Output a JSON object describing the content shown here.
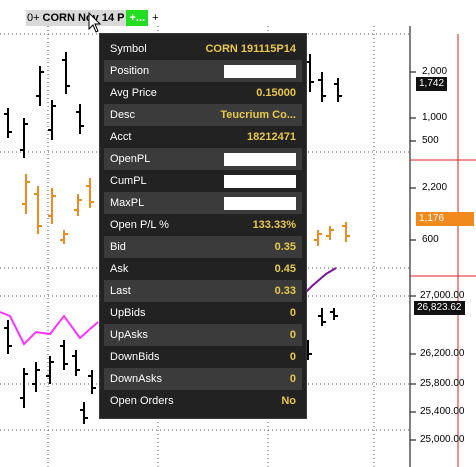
{
  "window": {
    "instrument_prefix": "0+",
    "instrument_title": "CORN Nov 14 P",
    "instrument_plus": "+...",
    "instrument_extra": "+"
  },
  "axes": {
    "top_labels": [
      "2,000",
      "1,000",
      "500"
    ],
    "top_badge": "1,742",
    "middle_labels": [
      "2,200",
      "600"
    ],
    "middle_badge": "1,176",
    "bottom_labels": [
      "27,000.00",
      "26,200.00",
      "25,800.00",
      "25,400.00",
      "25,000.00"
    ],
    "bottom_badge": "26,823.62"
  },
  "colors": {
    "popup_bg": "#222222",
    "popup_alt_row": "#3b3b3b",
    "label": "#ffffff",
    "value": "#e8c84a",
    "orange_series": "#f08a1c",
    "magenta_series": "#ff33ff",
    "purple_series": "#7a1a9a",
    "red_line": "#dd2222"
  },
  "popup": {
    "rows": [
      {
        "label": "Symbol",
        "value": "CORN 191115P14"
      },
      {
        "label": "Position",
        "value": ""
      },
      {
        "label": "Avg Price",
        "value": "0.15000"
      },
      {
        "label": "Desc",
        "value": "Teucrium Co..."
      },
      {
        "label": "Acct",
        "value": "18212471"
      },
      {
        "label": "OpenPL",
        "value": ""
      },
      {
        "label": "CumPL",
        "value": ""
      },
      {
        "label": "MaxPL",
        "value": ""
      },
      {
        "label": "Open P/L %",
        "value": "133.33%"
      },
      {
        "label": "Bid",
        "value": "0.35"
      },
      {
        "label": "Ask",
        "value": "0.45"
      },
      {
        "label": "Last",
        "value": "0.33"
      },
      {
        "label": "UpBids",
        "value": "0"
      },
      {
        "label": "UpAsks",
        "value": "0"
      },
      {
        "label": "DownBids",
        "value": "0"
      },
      {
        "label": "DownAsks",
        "value": "0"
      },
      {
        "label": "Open Orders",
        "value": "No"
      }
    ]
  }
}
